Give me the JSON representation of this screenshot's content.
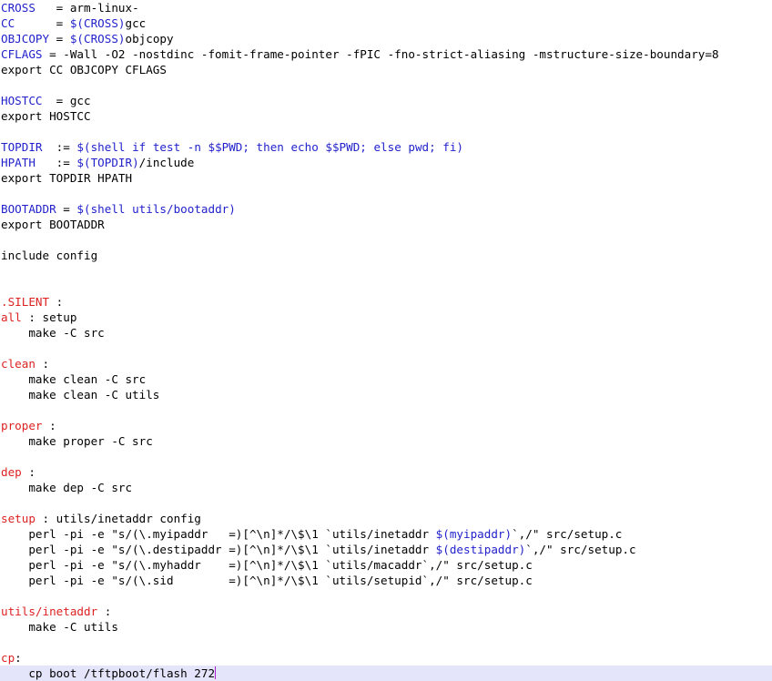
{
  "document": {
    "kind": "makefile-source-listing",
    "colors": {
      "background": "#ffffff",
      "text": "#000000",
      "variable": "#2222cc",
      "target": "#dd2222",
      "current_line_highlight": "#e4e4fa",
      "caret": "#aa22cc"
    },
    "lines": [
      {
        "segments": [
          {
            "t": "CROSS   ",
            "c": "var"
          },
          {
            "t": "= arm-linux-",
            "c": "plain"
          }
        ]
      },
      {
        "segments": [
          {
            "t": "CC      ",
            "c": "var"
          },
          {
            "t": "= ",
            "c": "plain"
          },
          {
            "t": "$(CROSS)",
            "c": "var"
          },
          {
            "t": "gcc",
            "c": "plain"
          }
        ]
      },
      {
        "segments": [
          {
            "t": "OBJCOPY ",
            "c": "var"
          },
          {
            "t": "= ",
            "c": "plain"
          },
          {
            "t": "$(CROSS)",
            "c": "var"
          },
          {
            "t": "objcopy",
            "c": "plain"
          }
        ]
      },
      {
        "segments": [
          {
            "t": "CFLAGS ",
            "c": "var"
          },
          {
            "t": "= -Wall -O2 -nostdinc -fomit-frame-pointer -fPIC -fno-strict-aliasing -mstructure-size-boundary=8",
            "c": "plain"
          }
        ]
      },
      {
        "segments": [
          {
            "t": "export CC OBJCOPY CFLAGS",
            "c": "plain"
          }
        ]
      },
      {
        "segments": [
          {
            "t": "",
            "c": "plain"
          }
        ]
      },
      {
        "segments": [
          {
            "t": "HOSTCC ",
            "c": "var"
          },
          {
            "t": " = gcc",
            "c": "plain"
          }
        ]
      },
      {
        "segments": [
          {
            "t": "export HOSTCC",
            "c": "plain"
          }
        ]
      },
      {
        "segments": [
          {
            "t": "",
            "c": "plain"
          }
        ]
      },
      {
        "segments": [
          {
            "t": "TOPDIR ",
            "c": "var"
          },
          {
            "t": " := ",
            "c": "plain"
          },
          {
            "t": "$(shell if test -n $$PWD; then echo $$PWD; else pwd; fi)",
            "c": "var"
          }
        ]
      },
      {
        "segments": [
          {
            "t": "HPATH  ",
            "c": "var"
          },
          {
            "t": " := ",
            "c": "plain"
          },
          {
            "t": "$(TOPDIR)",
            "c": "var"
          },
          {
            "t": "/include",
            "c": "plain"
          }
        ]
      },
      {
        "segments": [
          {
            "t": "export TOPDIR HPATH",
            "c": "plain"
          }
        ]
      },
      {
        "segments": [
          {
            "t": "",
            "c": "plain"
          }
        ]
      },
      {
        "segments": [
          {
            "t": "BOOTADDR ",
            "c": "var"
          },
          {
            "t": "= ",
            "c": "plain"
          },
          {
            "t": "$(shell utils/bootaddr)",
            "c": "var"
          }
        ]
      },
      {
        "segments": [
          {
            "t": "export BOOTADDR",
            "c": "plain"
          }
        ]
      },
      {
        "segments": [
          {
            "t": "",
            "c": "plain"
          }
        ]
      },
      {
        "segments": [
          {
            "t": "include config",
            "c": "plain"
          }
        ]
      },
      {
        "segments": [
          {
            "t": "",
            "c": "plain"
          }
        ]
      },
      {
        "segments": [
          {
            "t": "",
            "c": "plain"
          }
        ]
      },
      {
        "segments": [
          {
            "t": ".SILENT",
            "c": "target"
          },
          {
            "t": " :",
            "c": "plain"
          }
        ]
      },
      {
        "segments": [
          {
            "t": "all",
            "c": "target"
          },
          {
            "t": " : setup",
            "c": "plain"
          }
        ]
      },
      {
        "segments": [
          {
            "t": "    make -C src",
            "c": "plain"
          }
        ]
      },
      {
        "segments": [
          {
            "t": "",
            "c": "plain"
          }
        ]
      },
      {
        "segments": [
          {
            "t": "clean",
            "c": "target"
          },
          {
            "t": " :",
            "c": "plain"
          }
        ]
      },
      {
        "segments": [
          {
            "t": "    make clean -C src",
            "c": "plain"
          }
        ]
      },
      {
        "segments": [
          {
            "t": "    make clean -C utils",
            "c": "plain"
          }
        ]
      },
      {
        "segments": [
          {
            "t": "",
            "c": "plain"
          }
        ]
      },
      {
        "segments": [
          {
            "t": "proper",
            "c": "target"
          },
          {
            "t": " :",
            "c": "plain"
          }
        ]
      },
      {
        "segments": [
          {
            "t": "    make proper -C src",
            "c": "plain"
          }
        ]
      },
      {
        "segments": [
          {
            "t": "",
            "c": "plain"
          }
        ]
      },
      {
        "segments": [
          {
            "t": "dep",
            "c": "target"
          },
          {
            "t": " :",
            "c": "plain"
          }
        ]
      },
      {
        "segments": [
          {
            "t": "    make dep -C src",
            "c": "plain"
          }
        ]
      },
      {
        "segments": [
          {
            "t": "",
            "c": "plain"
          }
        ]
      },
      {
        "segments": [
          {
            "t": "setup",
            "c": "target"
          },
          {
            "t": " : utils/inetaddr config",
            "c": "plain"
          }
        ]
      },
      {
        "segments": [
          {
            "t": "    perl -pi -e \"s/(\\.myipaddr   =)[^\\n]*/\\$\\1 `utils/inetaddr ",
            "c": "plain"
          },
          {
            "t": "$(myipaddr)",
            "c": "var"
          },
          {
            "t": "`,/\" src/setup.c",
            "c": "plain"
          }
        ]
      },
      {
        "segments": [
          {
            "t": "    perl -pi -e \"s/(\\.destipaddr =)[^\\n]*/\\$\\1 `utils/inetaddr ",
            "c": "plain"
          },
          {
            "t": "$(destipaddr)",
            "c": "var"
          },
          {
            "t": "`,/\" src/setup.c",
            "c": "plain"
          }
        ]
      },
      {
        "segments": [
          {
            "t": "    perl -pi -e \"s/(\\.myhaddr    =)[^\\n]*/\\$\\1 `utils/macaddr`,/\" src/setup.c",
            "c": "plain"
          }
        ]
      },
      {
        "segments": [
          {
            "t": "    perl -pi -e \"s/(\\.sid        =)[^\\n]*/\\$\\1 `utils/setupid`,/\" src/setup.c",
            "c": "plain"
          }
        ]
      },
      {
        "segments": [
          {
            "t": "",
            "c": "plain"
          }
        ]
      },
      {
        "segments": [
          {
            "t": "utils/inetaddr",
            "c": "target"
          },
          {
            "t": " :",
            "c": "plain"
          }
        ]
      },
      {
        "segments": [
          {
            "t": "    make -C utils",
            "c": "plain"
          }
        ]
      },
      {
        "segments": [
          {
            "t": "",
            "c": "plain"
          }
        ]
      },
      {
        "segments": [
          {
            "t": "cp",
            "c": "target"
          },
          {
            "t": ":",
            "c": "plain"
          }
        ]
      },
      {
        "current": true,
        "caret_after": true,
        "segments": [
          {
            "t": "    cp boot /tftpboot/flash 272",
            "c": "plain"
          }
        ]
      }
    ]
  }
}
